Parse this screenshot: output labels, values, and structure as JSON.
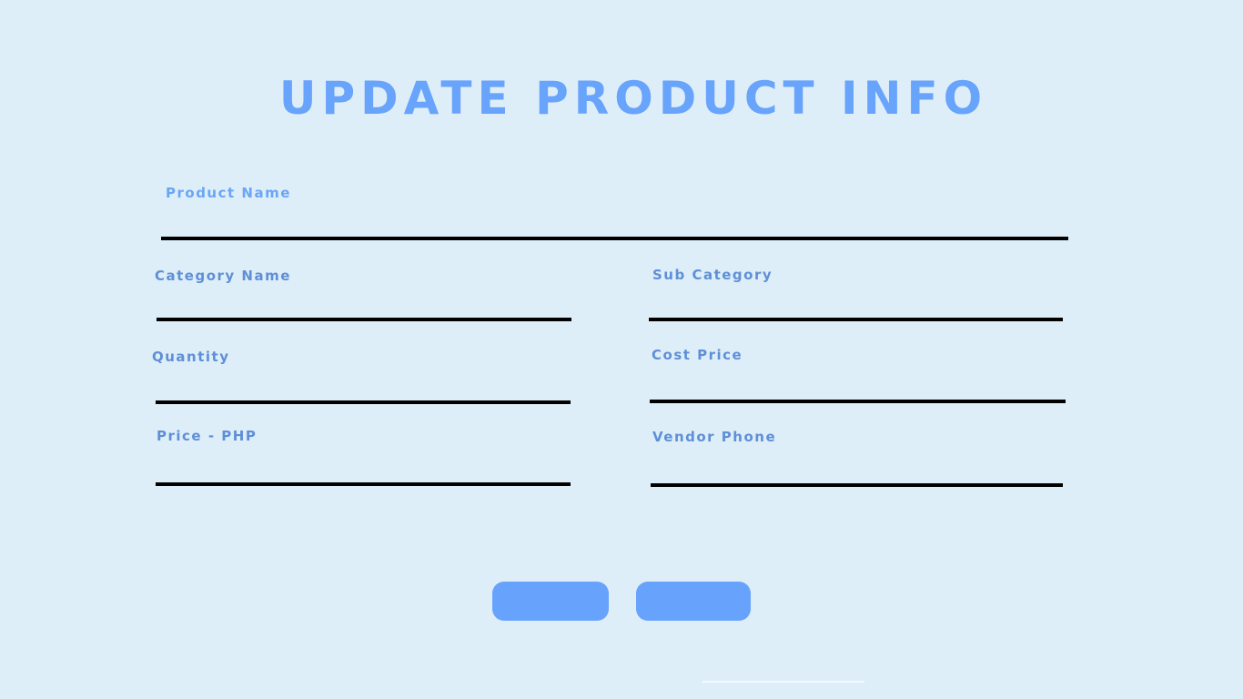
{
  "header": {
    "title": "UPDATE PRODUCT INFO"
  },
  "form": {
    "product_name": {
      "label": "Product Name",
      "value": ""
    },
    "category_name": {
      "label": "Category Name",
      "value": ""
    },
    "sub_category": {
      "label": "Sub Category",
      "value": ""
    },
    "quantity": {
      "label": "Quantity",
      "value": ""
    },
    "cost_price": {
      "label": "Cost Price",
      "value": ""
    },
    "price_php": {
      "label": "Price - PHP",
      "value": ""
    },
    "vendor_phone": {
      "label": "Vendor Phone",
      "value": ""
    }
  },
  "actions": {
    "primary_label": "",
    "secondary_label": ""
  },
  "colors": {
    "background": "#ddeef9",
    "accent": "#68a3fc",
    "label": "#5f8fd6",
    "underline": "#000000"
  }
}
